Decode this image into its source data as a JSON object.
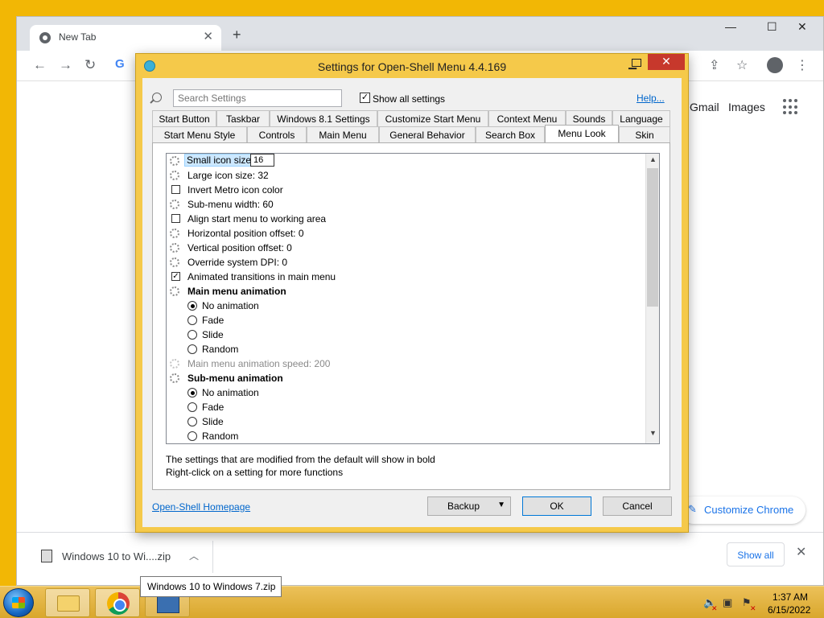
{
  "chrome": {
    "tab_title": "New Tab",
    "tab_close": "✕",
    "new_tab": "+",
    "minimize": "—",
    "maximize": "☐",
    "close": "✕",
    "nav_back": "←",
    "nav_forward": "→",
    "reload": "↻",
    "google_g": "G",
    "share_icon": "⇪",
    "star_icon": "☆",
    "menu_icon": "⋮",
    "gmail": "Gmail",
    "images": "Images",
    "customize": "Customize Chrome",
    "pencil": "✎"
  },
  "downloads": {
    "item_name": "Windows 10 to Wi....zip",
    "chevron": "︿",
    "show_all": "Show all",
    "close": "✕",
    "tooltip": "Windows 10 to Windows 7.zip"
  },
  "dialog": {
    "title": "Settings for Open-Shell Menu 4.4.169",
    "minimize": "▁",
    "close": "✕",
    "search_placeholder": "Search Settings",
    "show_all_label": "Show all settings",
    "show_all_checked": "✓",
    "help": "Help...",
    "tabs_row1": [
      "Start Button",
      "Taskbar",
      "Windows 8.1 Settings",
      "Customize Start Menu",
      "Context Menu",
      "Sounds",
      "Language"
    ],
    "tabs_row2": [
      "Start Menu Style",
      "Controls",
      "Main Menu",
      "General Behavior",
      "Search Box",
      "Menu Look",
      "Skin"
    ],
    "active_tab": "Menu Look",
    "settings": {
      "small_icon_label": "Small icon size",
      "small_icon_value": "16",
      "large_icon": "Large icon size: 32",
      "invert_metro": "Invert Metro icon color",
      "submenu_width": "Sub-menu width: 60",
      "align_start": "Align start menu to working area",
      "horiz_offset": "Horizontal position offset: 0",
      "vert_offset": "Vertical position offset: 0",
      "override_dpi": "Override system DPI: 0",
      "animated_transitions": "Animated transitions in main menu",
      "animated_checked": "✓",
      "main_anim": "Main menu animation",
      "main_anim_options": [
        "No animation",
        "Fade",
        "Slide",
        "Random"
      ],
      "main_anim_speed": "Main menu animation speed: 200",
      "sub_anim": "Sub-menu animation",
      "sub_anim_options": [
        "No animation",
        "Fade",
        "Slide",
        "Random"
      ],
      "selected_option": "No animation"
    },
    "scroll_up": "▲",
    "scroll_down": "▼",
    "hint_line1": "The settings that are modified from the default will show in bold",
    "hint_line2": "Right-click on a setting for more functions",
    "homepage": "Open-Shell Homepage",
    "backup": "Backup",
    "backup_arrow": "▼",
    "ok": "OK",
    "cancel": "Cancel"
  },
  "taskbar": {
    "time": "1:37 AM",
    "date": "6/15/2022",
    "tray_speaker": "🔈",
    "tray_network": "▣",
    "tray_flag": "⚑",
    "tray_x": "✕"
  }
}
